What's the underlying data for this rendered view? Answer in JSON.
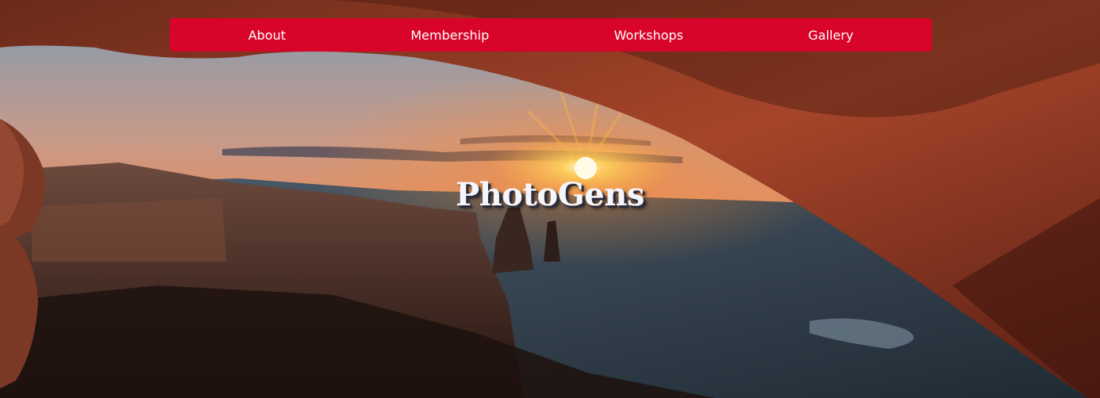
{
  "nav": {
    "items": [
      {
        "label": "About"
      },
      {
        "label": "Membership"
      },
      {
        "label": "Workshops"
      },
      {
        "label": "Gallery"
      }
    ]
  },
  "hero": {
    "title": "PhotoGens",
    "background": "sunrise-through-rock-arch-canyon-image"
  },
  "colors": {
    "nav_background": "#d90429",
    "nav_text": "#ffffff",
    "title_text": "#f4f6fb"
  }
}
